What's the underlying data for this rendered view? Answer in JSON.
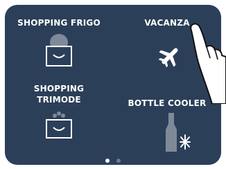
{
  "tiles": [
    {
      "label": "SHOPPING FRIGO",
      "icon": "shopping-frigo-icon"
    },
    {
      "label": "VACANZA",
      "icon": "airplane-icon"
    },
    {
      "label": "SHOPPING TRIMODE",
      "label_lines": [
        "SHOPPING",
        "TRIMODE"
      ],
      "icon": "shopping-trimode-icon"
    },
    {
      "label": "BOTTLE COOLER",
      "icon": "bottle-snowflake-icon"
    }
  ],
  "pager": {
    "pages": 2,
    "current": 1
  },
  "colors": {
    "screen_background": "#2c3f59",
    "text": "#ffffff",
    "icon_muted": "#7f8a99",
    "dot_active": "#ffffff",
    "dot_inactive": "#6d7b8f"
  },
  "overlay": {
    "icon": "pointing-hand-icon"
  }
}
